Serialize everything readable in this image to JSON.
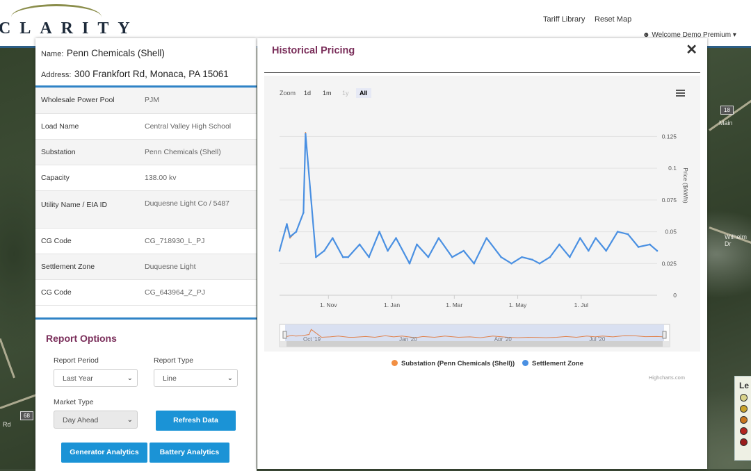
{
  "header": {
    "logo_text": "CLARITY",
    "nav": [
      "Tariff Library",
      "Reset Map"
    ],
    "welcome": "Welcome Demo Premium"
  },
  "map": {
    "labels": [
      "Wilhelm Dr",
      "Rd",
      "Main",
      "68",
      "18"
    ]
  },
  "site": {
    "name_key": "Name:",
    "name": "Penn Chemicals (Shell)",
    "address_key": "Address:",
    "address": "300 Frankfort Rd, Monaca, PA 15061"
  },
  "info_rows": [
    {
      "key": "Wholesale Power Pool",
      "value": "PJM"
    },
    {
      "key": "Load Name",
      "value": "Central Valley High School"
    },
    {
      "key": "Substation",
      "value": "Penn Chemicals (Shell)"
    },
    {
      "key": "Capacity",
      "value": "138.00 kv"
    },
    {
      "key": "Utility Name / EIA ID",
      "value": "Duquesne Light Co / 5487"
    },
    {
      "key": "CG Code",
      "value": "CG_718930_L_PJ"
    },
    {
      "key": "Settlement Zone",
      "value": "Duquesne Light"
    },
    {
      "key": "CG Code",
      "value": "CG_643964_Z_PJ"
    }
  ],
  "report": {
    "title": "Report Options",
    "period_label": "Report Period",
    "period_value": "Last Year",
    "type_label": "Report Type",
    "type_value": "Line",
    "market_label": "Market Type",
    "market_value": "Day Ahead",
    "refresh_button": "Refresh Data",
    "generator_button": "Generator Analytics",
    "battery_button": "Battery Analytics"
  },
  "modal": {
    "title": "Historical Pricing",
    "close": "✕",
    "zoom_label": "Zoom",
    "zoom_options": [
      "1d",
      "1m",
      "1y",
      "All"
    ],
    "active_zoom": "All",
    "credits": "Highcharts.com"
  },
  "map_legend": {
    "title": "Le",
    "colors": [
      "#d9d28a",
      "#c9a22a",
      "#c9761e",
      "#b3241f",
      "#9a1c1c"
    ]
  },
  "chart_data": {
    "type": "line",
    "ylabel": "Price ($/kWh)",
    "y_ticks": [
      0,
      0.025,
      0.05,
      0.075,
      0.1,
      0.125
    ],
    "y_tick_labels": [
      "0",
      "0.025",
      "0.05",
      "0.075",
      "0.1",
      "0.125"
    ],
    "ylim": [
      0,
      0.14
    ],
    "x_tick_labels": [
      "1. Nov",
      "1. Jan",
      "1. Mar",
      "1. May",
      "1. Jul"
    ],
    "navigator_labels": [
      "Oct '19",
      "Jan '20",
      "Apr '20",
      "Jul '20"
    ],
    "series": [
      {
        "name": "Substation (Penn Chemicals (Shell))",
        "color": "#f28f43",
        "x": [
          "2019-09-15",
          "2019-09-22",
          "2019-09-25",
          "2019-10-01",
          "2019-10-08",
          "2019-10-10",
          "2019-10-20",
          "2019-10-28",
          "2019-11-05",
          "2019-11-15",
          "2019-11-20",
          "2019-12-01",
          "2019-12-10",
          "2019-12-20",
          "2019-12-28",
          "2020-01-05",
          "2020-01-18",
          "2020-01-25",
          "2020-02-05",
          "2020-02-15",
          "2020-02-28",
          "2020-03-10",
          "2020-03-20",
          "2020-04-01",
          "2020-04-15",
          "2020-04-25",
          "2020-05-05",
          "2020-05-15",
          "2020-05-22",
          "2020-06-01",
          "2020-06-10",
          "2020-06-20",
          "2020-06-30",
          "2020-07-08",
          "2020-07-15",
          "2020-07-25",
          "2020-08-05",
          "2020-08-15",
          "2020-08-25",
          "2020-09-05",
          "2020-09-12"
        ],
        "values": [
          0.035,
          0.055,
          0.045,
          0.05,
          0.065,
          0.128,
          0.03,
          0.035,
          0.045,
          0.03,
          0.03,
          0.04,
          0.03,
          0.05,
          0.035,
          0.045,
          0.025,
          0.04,
          0.03,
          0.045,
          0.03,
          0.035,
          0.025,
          0.045,
          0.03,
          0.025,
          0.03,
          0.028,
          0.025,
          0.03,
          0.04,
          0.03,
          0.045,
          0.035,
          0.045,
          0.035,
          0.05,
          0.048,
          0.038,
          0.04,
          0.035
        ]
      },
      {
        "name": "Settlement Zone",
        "color": "#4a90e2",
        "x": [
          "2019-09-15",
          "2019-09-22",
          "2019-09-25",
          "2019-10-01",
          "2019-10-08",
          "2019-10-10",
          "2019-10-20",
          "2019-10-28",
          "2019-11-05",
          "2019-11-15",
          "2019-11-20",
          "2019-12-01",
          "2019-12-10",
          "2019-12-20",
          "2019-12-28",
          "2020-01-05",
          "2020-01-18",
          "2020-01-25",
          "2020-02-05",
          "2020-02-15",
          "2020-02-28",
          "2020-03-10",
          "2020-03-20",
          "2020-04-01",
          "2020-04-15",
          "2020-04-25",
          "2020-05-05",
          "2020-05-15",
          "2020-05-22",
          "2020-06-01",
          "2020-06-10",
          "2020-06-20",
          "2020-06-30",
          "2020-07-08",
          "2020-07-15",
          "2020-07-25",
          "2020-08-05",
          "2020-08-15",
          "2020-08-25",
          "2020-09-05",
          "2020-09-12"
        ],
        "values": [
          0.035,
          0.056,
          0.046,
          0.05,
          0.065,
          0.127,
          0.03,
          0.035,
          0.045,
          0.03,
          0.03,
          0.04,
          0.03,
          0.05,
          0.035,
          0.045,
          0.025,
          0.04,
          0.03,
          0.045,
          0.03,
          0.035,
          0.025,
          0.045,
          0.03,
          0.025,
          0.03,
          0.028,
          0.025,
          0.03,
          0.04,
          0.03,
          0.045,
          0.035,
          0.045,
          0.035,
          0.05,
          0.048,
          0.038,
          0.04,
          0.035
        ]
      }
    ]
  }
}
